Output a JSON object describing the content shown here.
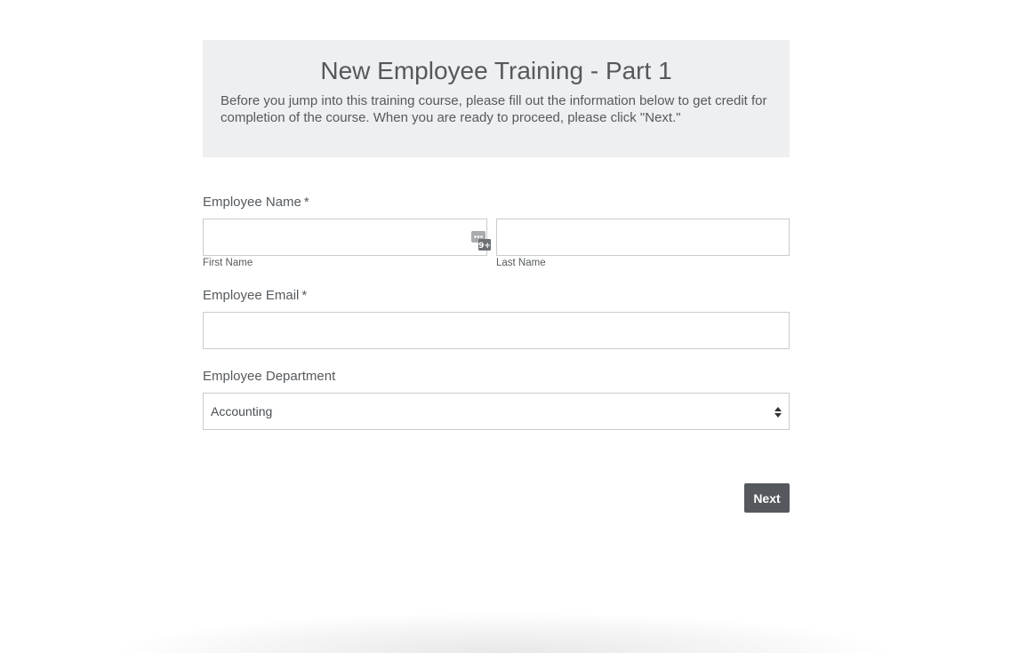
{
  "form": {
    "title": "New Employee Training - Part 1",
    "description": "Before you jump into this training course, please fill out the information below to get credit for completion of the course. When you are ready to proceed, please click \"Next.\""
  },
  "fields": {
    "name": {
      "label": "Employee Name",
      "required_mark": "*",
      "first_sublabel": "First Name",
      "last_sublabel": "Last Name",
      "first_value": "",
      "last_value": ""
    },
    "email": {
      "label": "Employee Email",
      "required_mark": "*",
      "value": ""
    },
    "department": {
      "label": "Employee Department",
      "selected": "Accounting"
    }
  },
  "actions": {
    "next_label": "Next"
  },
  "icons": {
    "password_manager": "password-manager-icon",
    "select_arrows": "select-arrows-icon"
  },
  "colors": {
    "header_bg": "#eeeff0",
    "button_bg": "#55595e",
    "border": "#c9cbcd",
    "text": "#555a5e"
  }
}
